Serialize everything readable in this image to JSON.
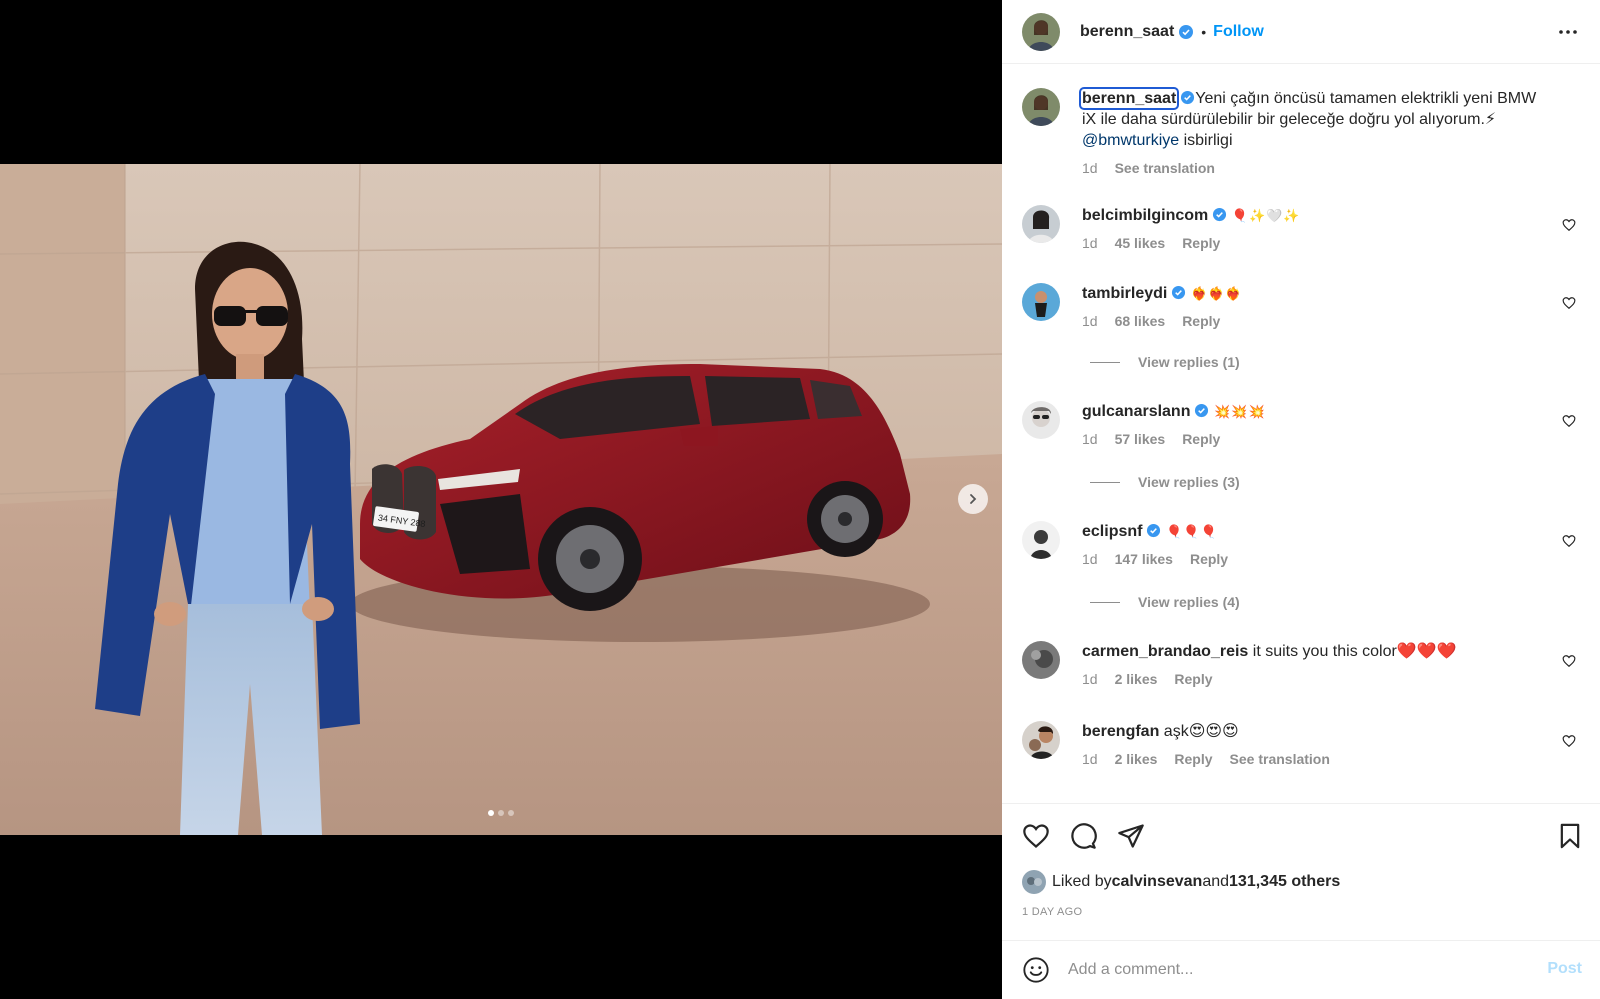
{
  "post": {
    "author": "berenn_saat",
    "follow_label": "Follow",
    "separator": "•",
    "caption_text": "Yeni çağın öncüsü tamamen elektrikli yeni BMW iX ile daha sürdürülebilir bir geleceğe doğru yol alıyorum.⚡ ",
    "caption_mention": "@bmwturkiye",
    "caption_tail": " isbirligi",
    "caption_time": "1d",
    "see_translation": "See translation",
    "photo_plate": "34 FNY 288",
    "carousel": {
      "count": 3,
      "active_index": 0
    }
  },
  "comments": [
    {
      "user": "belcimbilgincom",
      "verified": true,
      "text": " 🎈✨🤍✨",
      "time": "1d",
      "likes": "45 likes",
      "reply": "Reply"
    },
    {
      "user": "tambirleydi",
      "verified": true,
      "text": " ❤️‍🔥❤️‍🔥❤️‍🔥",
      "time": "1d",
      "likes": "68 likes",
      "reply": "Reply",
      "view_replies": "View replies (1)"
    },
    {
      "user": "gulcanarslann",
      "verified": true,
      "text": " 💥💥💥",
      "time": "1d",
      "likes": "57 likes",
      "reply": "Reply",
      "view_replies": "View replies (3)"
    },
    {
      "user": "eclipsnf",
      "verified": true,
      "text": " 🎈🎈🎈",
      "time": "1d",
      "likes": "147 likes",
      "reply": "Reply",
      "view_replies": "View replies (4)"
    },
    {
      "user": "carmen_brandao_reis",
      "verified": false,
      "text": " it suits you this color❤️❤️❤️",
      "time": "1d",
      "likes": "2 likes",
      "reply": "Reply"
    },
    {
      "user": "berengfan",
      "verified": false,
      "text": " aşk😍😍😍",
      "time": "1d",
      "likes": "2 likes",
      "reply": "Reply",
      "see_translation": "See translation"
    }
  ],
  "likes": {
    "prefix": "Liked by ",
    "user": "calvinsevan",
    "middle": " and ",
    "others": "131,345 others"
  },
  "timestamp": "1 DAY AGO",
  "composer": {
    "placeholder": "Add a comment...",
    "post_label": "Post"
  },
  "colors": {
    "accent": "#0095f6",
    "verified": "#3897f0",
    "muted": "#8e8e8e"
  },
  "icons": [
    "verified-icon",
    "more-icon",
    "heart-icon",
    "comment-icon",
    "share-icon",
    "bookmark-icon",
    "emoji-icon",
    "chevron-right-icon"
  ]
}
